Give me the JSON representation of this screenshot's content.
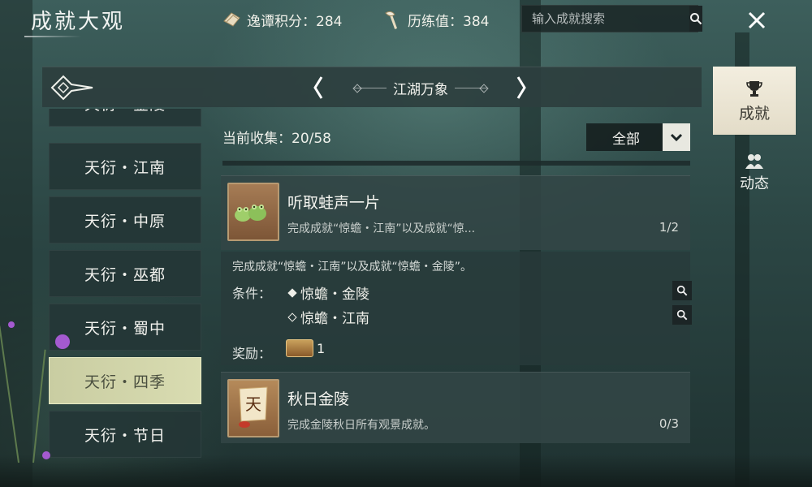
{
  "header": {
    "title": "成就大观",
    "points_label": "逸谭积分：284",
    "experience_label": "历练值：384",
    "search_placeholder": "输入成就搜索"
  },
  "category": {
    "title": "江湖万象"
  },
  "sidebar": {
    "items": [
      {
        "label": "天衍・金陵"
      },
      {
        "label": "天衍・江南"
      },
      {
        "label": "天衍・中原"
      },
      {
        "label": "天衍・巫都"
      },
      {
        "label": "天衍・蜀中"
      },
      {
        "label": "天衍・四季",
        "active": true
      },
      {
        "label": "天衍・节日"
      }
    ]
  },
  "content": {
    "collection_label": "当前收集：20/58",
    "filter": {
      "selected": "全部"
    },
    "achievements": [
      {
        "title": "听取蛙声一片",
        "summary": "完成成就“惊蟾・江南”以及成就“惊...",
        "progress": "1/2",
        "detail": {
          "description": "完成成就“惊蟾・江南”以及成就“惊蟾・金陵”。",
          "conditions_label": "条件：",
          "conditions": [
            {
              "text": "惊蟾・金陵",
              "done": true
            },
            {
              "text": "惊蟾・江南",
              "done": false
            }
          ],
          "reward_label": "奖励：",
          "reward_count": "1"
        }
      },
      {
        "title": "秋日金陵",
        "summary": "完成金陵秋日所有观景成就。",
        "progress": "0/3",
        "icon_glyph": "天"
      }
    ]
  },
  "right_tabs": {
    "achievement": "成就",
    "dynamic": "动态"
  },
  "colors": {
    "active_tab": "#d9dcb1",
    "panel": "#2c3e3e",
    "accent_cream": "#f3eedf"
  }
}
